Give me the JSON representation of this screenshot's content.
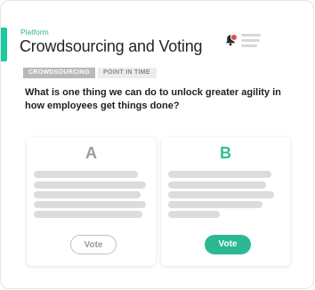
{
  "header": {
    "platform_label": "Platform",
    "title": "Crowdsourcing and Voting",
    "notification_icon": "bell-icon",
    "notification_badge_color": "#e84a4a"
  },
  "tags": [
    {
      "label": "CROWDSOURCING"
    },
    {
      "label": "POINT IN TIME"
    }
  ],
  "question": "What is one thing we can do to unlock greater agility in how employees get things done?",
  "options": [
    {
      "letter": "A",
      "vote_label": "Vote",
      "selected": false
    },
    {
      "letter": "B",
      "vote_label": "Vote",
      "selected": true
    }
  ],
  "colors": {
    "accent": "#1ec8a0",
    "vote_selected": "#2bb894",
    "option_b_letter": "#2fbf9a"
  }
}
